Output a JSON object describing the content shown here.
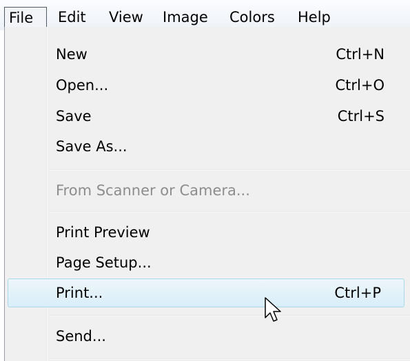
{
  "menubar": {
    "items": [
      "File",
      "Edit",
      "View",
      "Image",
      "Colors",
      "Help"
    ]
  },
  "file_menu": {
    "new": {
      "label": "New",
      "shortcut": "Ctrl+N"
    },
    "open": {
      "label": "Open...",
      "shortcut": "Ctrl+O"
    },
    "save": {
      "label": "Save",
      "shortcut": "Ctrl+S"
    },
    "save_as": {
      "label": "Save As..."
    },
    "from_scanner": {
      "label": "From Scanner or Camera...",
      "disabled": true
    },
    "print_preview": {
      "label": "Print Preview"
    },
    "page_setup": {
      "label": "Page Setup..."
    },
    "print": {
      "label": "Print...",
      "shortcut": "Ctrl+P",
      "highlighted": true
    },
    "send": {
      "label": "Send..."
    }
  },
  "cursor": {
    "icon": "arrow-pointer-icon"
  },
  "colors": {
    "menu_background": "#f0f0f0",
    "highlight_fill": "#d9eef9",
    "highlight_border": "#a8d8eb",
    "disabled_text": "#8d8d8d"
  }
}
